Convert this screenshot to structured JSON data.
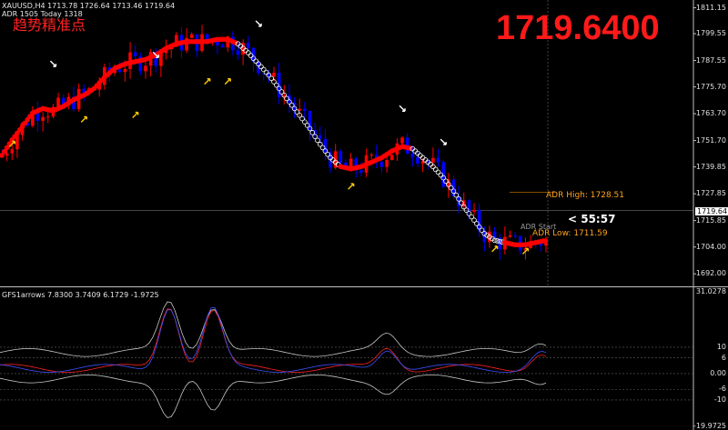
{
  "header": {
    "symbol_line": "XAUUSD,H4  1713.78 1726.64 1713.46 1719.64",
    "adr_line": "ADR 1505  Today 1318"
  },
  "chinese_title": "趋势精准点",
  "big_price": "1719.6400",
  "adr": {
    "high_label": "ADR High: 1728.51",
    "low_label": "ADR Low: 1711.59",
    "stop_label": "ADR Start"
  },
  "timer": "< 55:57",
  "current_price": "1719.64",
  "sub_label": "GFS1arrows 7.8300 3.7409 6.1729 -1.9725",
  "colors": {
    "bull_candle": "#ff0000",
    "bear_candle": "#0000ff",
    "trend_up": "#ff0000",
    "trend_down": "#ffffff",
    "arrow_yellow": "#ffcc00",
    "arrow_white": "#ffffff",
    "axis": "#c0c0c0"
  },
  "chart_data": [
    {
      "type": "line",
      "title": "XAUUSD,H4",
      "y_axis_ticks": [
        "1811.15",
        "1799.55",
        "1787.55",
        "1775.70",
        "1763.70",
        "1751.70",
        "1739.85",
        "1727.85",
        "1715.85",
        "1704.00",
        "1692.00"
      ],
      "ylim": [
        1688,
        1813
      ],
      "series": [
        {
          "name": "",
          "values": [
            1745,
            1752,
            1758,
            1764,
            1766,
            1765,
            1767,
            1770,
            1772,
            1775,
            1780,
            1784,
            1786,
            1787,
            1788,
            1790,
            1793,
            1795,
            1796,
            1796,
            1796,
            1797,
            1797,
            1795,
            1791,
            1786,
            1781,
            1775,
            1769,
            1763,
            1757,
            1750,
            1744,
            1740,
            1739,
            1740,
            1742,
            1744,
            1747,
            1749,
            1748,
            1744,
            1740,
            1735,
            1729,
            1722,
            1716,
            1710,
            1707,
            1706,
            1705,
            1705,
            1706,
            1707
          ]
        }
      ]
    },
    {
      "type": "line",
      "title": "GFS1arrows",
      "y_axis_ticks": [
        "31.0278",
        "10",
        "6",
        "0.00",
        "-6",
        "-10",
        "-19.9725"
      ],
      "ylim": [
        -20,
        31
      ],
      "series": [
        {
          "name": "7.8300"
        },
        {
          "name": "3.7409"
        },
        {
          "name": "6.1729"
        },
        {
          "name": "-1.9725"
        }
      ]
    }
  ]
}
